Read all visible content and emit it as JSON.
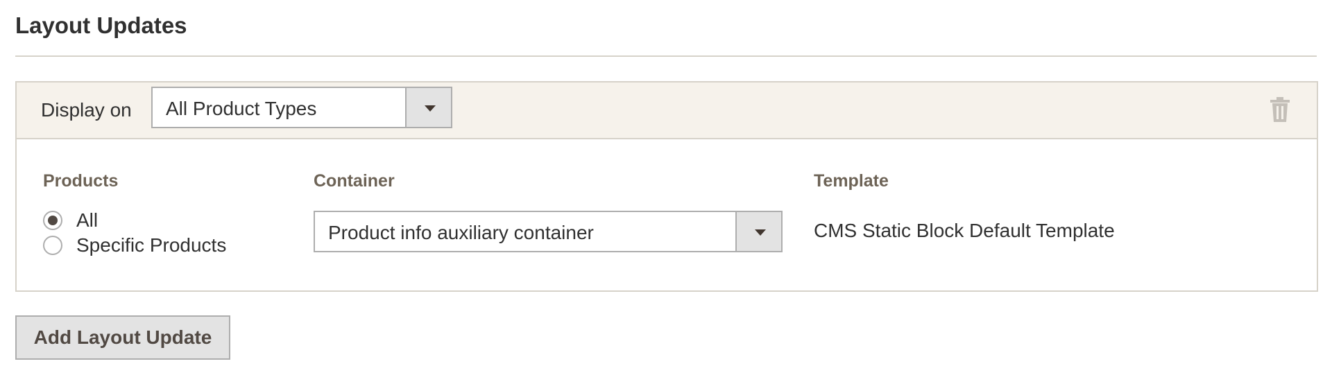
{
  "section": {
    "title": "Layout Updates"
  },
  "layout_update": {
    "display_on_label": "Display on",
    "display_on_select": {
      "value": "All Product Types"
    },
    "delete_icon": "trash-icon",
    "products": {
      "label": "Products",
      "options": [
        {
          "label": "All",
          "checked": true
        },
        {
          "label": "Specific Products",
          "checked": false
        }
      ]
    },
    "container": {
      "label": "Container",
      "value": "Product info auxiliary container"
    },
    "template": {
      "label": "Template",
      "value": "CMS Static Block Default Template"
    }
  },
  "actions": {
    "add_button_label": "Add Layout Update"
  },
  "colors": {
    "text": "#303030",
    "label": "#6d6356",
    "header_bg": "#f6f2eb",
    "border": "#d6d2c9",
    "button_bg": "#e3e3e3"
  }
}
